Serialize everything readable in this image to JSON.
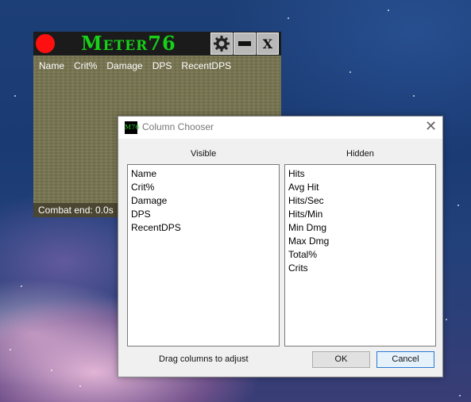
{
  "meter": {
    "title": "Meter76",
    "columns": [
      "Name",
      "Crit%",
      "Damage",
      "DPS",
      "RecentDPS"
    ],
    "status": "Combat end: 0.0s",
    "close_label": "X",
    "colors": {
      "title": "#18d018",
      "record": "#ff1010"
    }
  },
  "dialog": {
    "icon_text": "M76",
    "title": "Column Chooser",
    "visible_header": "Visible",
    "hidden_header": "Hidden",
    "visible_items": [
      "Name",
      "Crit%",
      "Damage",
      "DPS",
      "RecentDPS"
    ],
    "hidden_items": [
      "Hits",
      "Avg Hit",
      "Hits/Sec",
      "Hits/Min",
      "Min Dmg",
      "Max Dmg",
      "Total%",
      "Crits"
    ],
    "hint": "Drag columns to adjust",
    "ok_label": "OK",
    "cancel_label": "Cancel",
    "close_glyph": "✕"
  }
}
